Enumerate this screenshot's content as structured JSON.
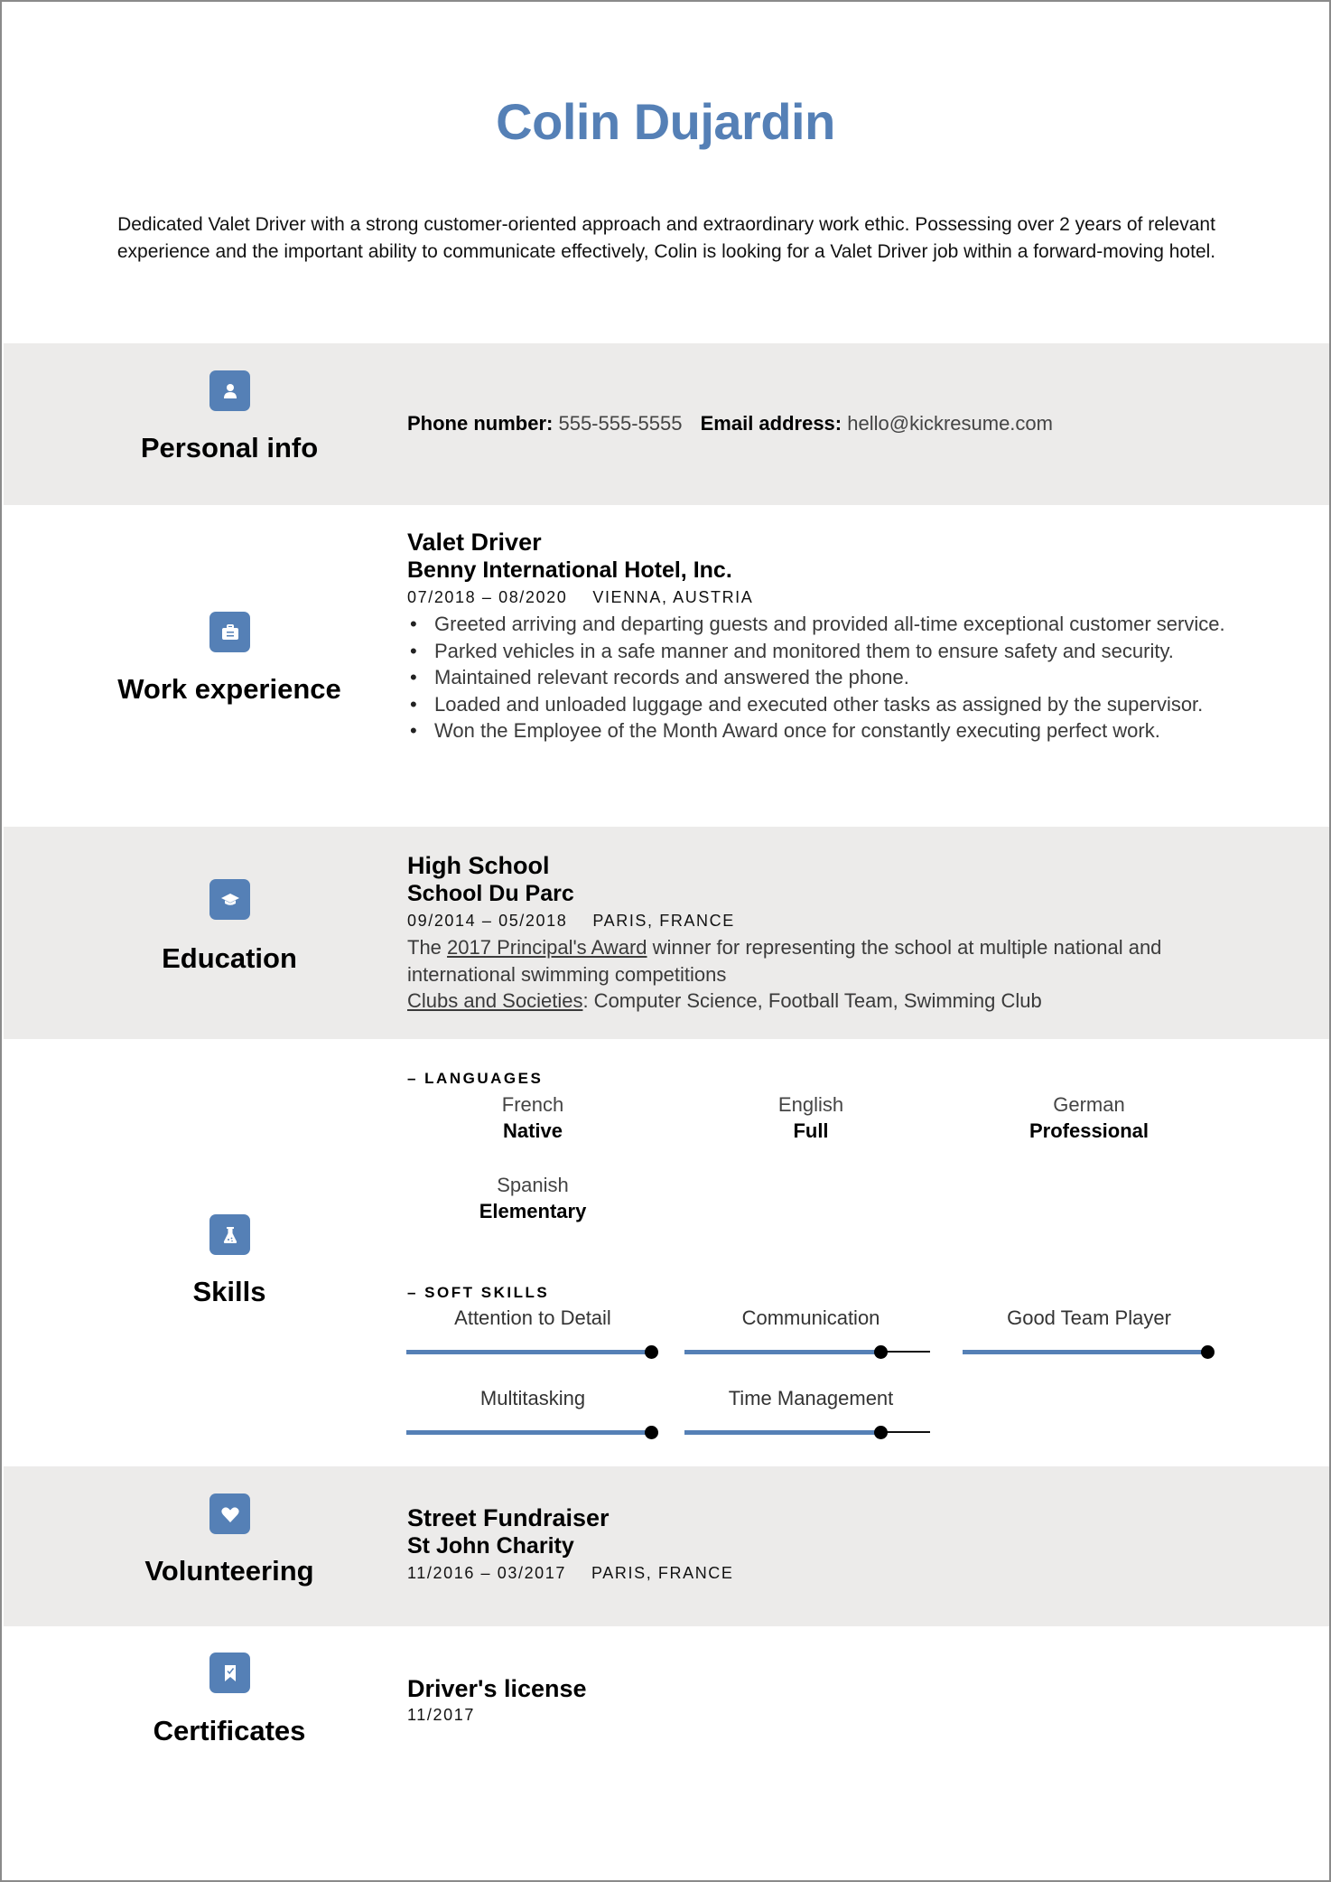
{
  "header": {
    "name": "Colin Dujardin",
    "summary": "Dedicated Valet Driver with a strong customer-oriented approach and extraordinary work ethic. Possessing over 2 years of relevant experience and the important ability to communicate effectively, Colin is looking for a Valet Driver job within a forward-moving hotel."
  },
  "colors": {
    "accent": "#5580b6",
    "band_gray": "#ecebea"
  },
  "personal_info": {
    "title": "Personal info",
    "icon": "person-icon",
    "phone_label": "Phone number:",
    "phone": "555-555-5555",
    "email_label": "Email address:",
    "email": "hello@kickresume.com"
  },
  "work": {
    "title": "Work experience",
    "icon": "briefcase-icon",
    "job_title": "Valet Driver",
    "company": "Benny International Hotel, Inc.",
    "dates": "07/2018 – 08/2020",
    "location": "VIENNA, AUSTRIA",
    "bullets": [
      "Greeted arriving and departing guests and provided all-time exceptional customer service.",
      "Parked vehicles in a safe manner and monitored them to ensure safety and security.",
      "Maintained relevant records and answered the phone.",
      "Loaded and unloaded luggage and executed other tasks as assigned by the supervisor.",
      "Won the Employee of the Month Award once for constantly executing perfect work."
    ]
  },
  "education": {
    "title": "Education",
    "icon": "graduation-cap-icon",
    "degree": "High School",
    "school": "School Du Parc",
    "dates": "09/2014 – 05/2018",
    "location": "PARIS, FRANCE",
    "desc_prefix": "The ",
    "desc_link": "2017 Principal's Award",
    "desc_suffix": " winner for representing the school at multiple national and international swimming competitions",
    "clubs_label": "Clubs and Societies",
    "clubs": ": Computer Science, Football Team, Swimming Club"
  },
  "skills": {
    "title": "Skills",
    "icon": "flask-icon",
    "languages_label": "– LANGUAGES",
    "languages": [
      {
        "name": "French",
        "level": "Native"
      },
      {
        "name": "English",
        "level": "Full"
      },
      {
        "name": "German",
        "level": "Professional"
      },
      {
        "name": "Spanish",
        "level": "Elementary"
      }
    ],
    "soft_label": "– SOFT SKILLS",
    "soft_skills": [
      {
        "name": "Attention to Detail",
        "level": 1.0
      },
      {
        "name": "Communication",
        "level": 0.8
      },
      {
        "name": "Good Team Player",
        "level": 1.0
      },
      {
        "name": "Multitasking",
        "level": 1.0
      },
      {
        "name": "Time Management",
        "level": 0.8
      }
    ]
  },
  "volunteering": {
    "title": "Volunteering",
    "icon": "heart-icon",
    "role": "Street Fundraiser",
    "org": "St John Charity",
    "dates": "11/2016 – 03/2017",
    "location": "PARIS, FRANCE"
  },
  "certificates": {
    "title": "Certificates",
    "icon": "certificate-ribbon-icon",
    "name": "Driver's license",
    "date": "11/2017"
  }
}
